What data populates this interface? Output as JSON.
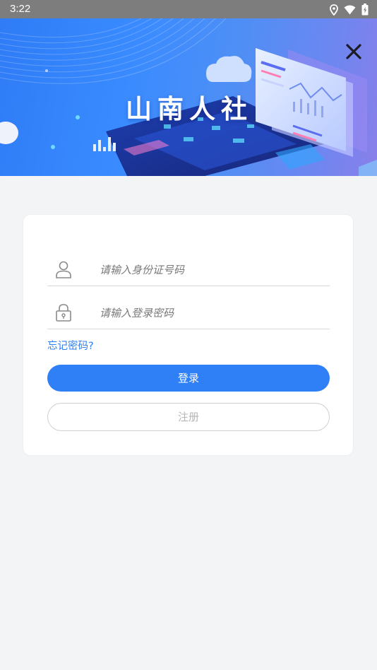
{
  "status_bar": {
    "time": "3:22"
  },
  "banner": {
    "title": "山南人社"
  },
  "login_form": {
    "id_placeholder": "请输入身份证号码",
    "password_placeholder": "请输入登录密码",
    "forgot_password": "忘记密码?",
    "login_button": "登录",
    "register_button": "注册"
  },
  "colors": {
    "primary": "#2f7ff6",
    "status_bar": "#7d7d7d",
    "page_bg": "#f3f4f6"
  },
  "icons": [
    "location-icon",
    "wifi-icon",
    "battery-icon",
    "close-icon",
    "user-icon",
    "lock-icon"
  ]
}
